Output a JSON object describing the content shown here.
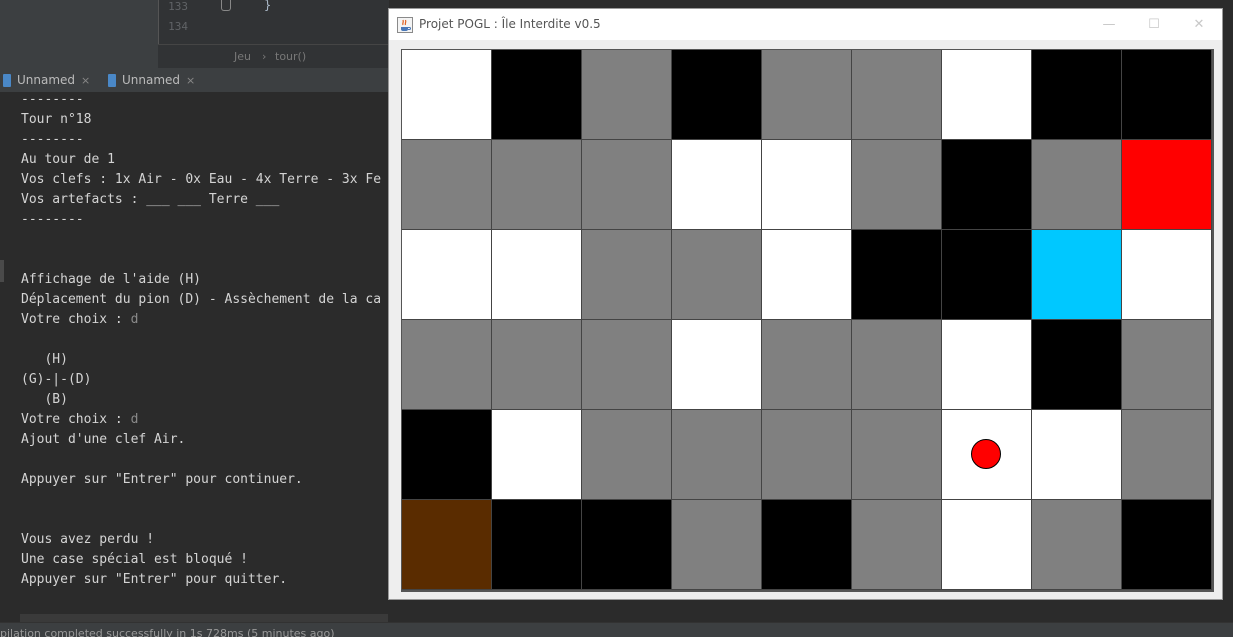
{
  "editor": {
    "line_numbers": [
      "133",
      "134"
    ],
    "code_brace": "}",
    "breadcrumb": [
      "Jeu",
      "tour()"
    ],
    "breadcrumb_separator": "›"
  },
  "run_tabs": [
    {
      "label": "Unnamed",
      "close": "×"
    },
    {
      "label": "Unnamed",
      "close": "×"
    }
  ],
  "console": {
    "lines": [
      {
        "text": "--------"
      },
      {
        "text": "Tour n°18"
      },
      {
        "text": "--------"
      },
      {
        "text": "Au tour de 1"
      },
      {
        "text": "Vos clefs : 1x Air - 0x Eau - 4x Terre - 3x Fe"
      },
      {
        "text": "Vos artefacts : ___ ___ Terre ___"
      },
      {
        "text": "--------"
      },
      {
        "text": ""
      },
      {
        "text": ""
      },
      {
        "text": "Affichage de l'aide (H)"
      },
      {
        "text": "Déplacement du pion (D) - Assèchement de la ca"
      },
      {
        "text": "Votre choix : ",
        "input": "d"
      },
      {
        "text": ""
      },
      {
        "text": "   (H)"
      },
      {
        "text": "(G)-|-(D)"
      },
      {
        "text": "   (B)"
      },
      {
        "text": "Votre choix : ",
        "input": "d"
      },
      {
        "text": "Ajout d'une clef Air."
      },
      {
        "text": ""
      },
      {
        "text": "Appuyer sur \"Entrer\" pour continuer."
      },
      {
        "text": ""
      },
      {
        "text": ""
      },
      {
        "text": "Vous avez perdu !"
      },
      {
        "text": "Une case spécial est bloqué !"
      },
      {
        "text": "Appuyer sur \"Entrer\" pour quitter."
      }
    ]
  },
  "status_bar": {
    "text": "pilation completed successfully in 1s 728ms (5 minutes ago)"
  },
  "game_window": {
    "title": "Projet POGL : Île Interdite v0.5",
    "buttons": {
      "minimize": "—",
      "maximize": "☐",
      "close": "✕"
    },
    "colors": {
      "white": "#ffffff",
      "black": "#000000",
      "gray": "#808080",
      "red": "#ff0000",
      "cyan": "#00c8ff",
      "brown": "#5a2c00"
    },
    "board": [
      [
        "white",
        "black",
        "gray",
        "black",
        "gray",
        "gray",
        "white",
        "black",
        "black"
      ],
      [
        "gray",
        "gray",
        "gray",
        "white",
        "white",
        "gray",
        "black",
        "gray",
        "red"
      ],
      [
        "white",
        "white",
        "gray",
        "gray",
        "white",
        "black",
        "black",
        "cyan",
        "white"
      ],
      [
        "gray",
        "gray",
        "gray",
        "white",
        "gray",
        "gray",
        "white",
        "black",
        "gray"
      ],
      [
        "black",
        "white",
        "gray",
        "gray",
        "gray",
        "gray",
        "white",
        "white",
        "gray"
      ],
      [
        "brown",
        "black",
        "black",
        "gray",
        "black",
        "gray",
        "white",
        "gray",
        "black"
      ]
    ],
    "pawn": {
      "row": 4,
      "col": 6,
      "color": "#ff0000"
    }
  }
}
